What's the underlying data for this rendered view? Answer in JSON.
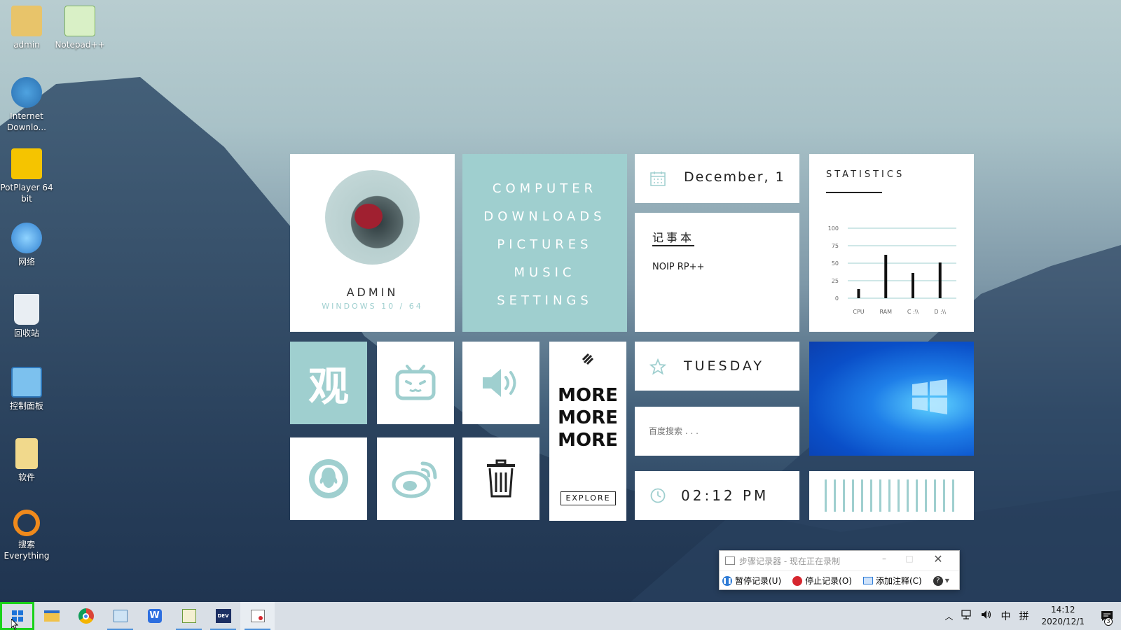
{
  "desktop_icons": [
    {
      "label": "admin",
      "icon": "user-folder-icon"
    },
    {
      "label": "Notepad++",
      "icon": "notepad-plus-icon"
    },
    {
      "label": "Internet Downlo...",
      "icon": "internet-download-manager-icon"
    },
    {
      "label": "PotPlayer 64 bit",
      "icon": "potplayer-icon"
    },
    {
      "label": "网络",
      "icon": "network-icon"
    },
    {
      "label": "回收站",
      "icon": "recycle-bin-icon"
    },
    {
      "label": "控制面板",
      "icon": "control-panel-icon"
    },
    {
      "label": "软件",
      "icon": "folder-icon"
    },
    {
      "label": "搜索 Everything",
      "icon": "everything-search-icon"
    }
  ],
  "profile": {
    "name": "ADMIN",
    "os": "WINDOWS 10 / 64"
  },
  "nav": [
    "COMPUTER",
    "DOWNLOADS",
    "PICTURES",
    "MUSIC",
    "SETTINGS"
  ],
  "date": {
    "text": "December, 1"
  },
  "notepad": {
    "title": "记事本",
    "content": "NOIP RP++"
  },
  "stats": {
    "title": "STATISTICS"
  },
  "chart_data": {
    "type": "bar",
    "categories": [
      "CPU",
      "RAM",
      "C :\\\\",
      "D :\\\\"
    ],
    "values": [
      13,
      62,
      36,
      51
    ],
    "yticks": [
      0,
      25,
      50,
      75,
      100
    ],
    "ylim": [
      0,
      100
    ],
    "grid": true
  },
  "day": {
    "text": "TUESDAY"
  },
  "search": {
    "placeholder": "百度搜索 . . ."
  },
  "time": {
    "text": "02:12 PM"
  },
  "more": {
    "lines": [
      "MORE",
      "MORE",
      "MORE"
    ],
    "button": "EXPLORE"
  },
  "app_tiles": {
    "guan_char": "观"
  },
  "steps_recorder": {
    "title": "步骤记录器 - 现在正在录制",
    "pause": "暂停记录(U)",
    "stop": "停止记录(O)",
    "comment": "添加注释(C)"
  },
  "tray": {
    "ime1": "中",
    "ime2": "拼",
    "clock_time": "14:12",
    "clock_date": "2020/12/1",
    "notif_count": "3"
  },
  "colors": {
    "teal": "#9fcfcf",
    "accent": "#4a8fd9"
  }
}
